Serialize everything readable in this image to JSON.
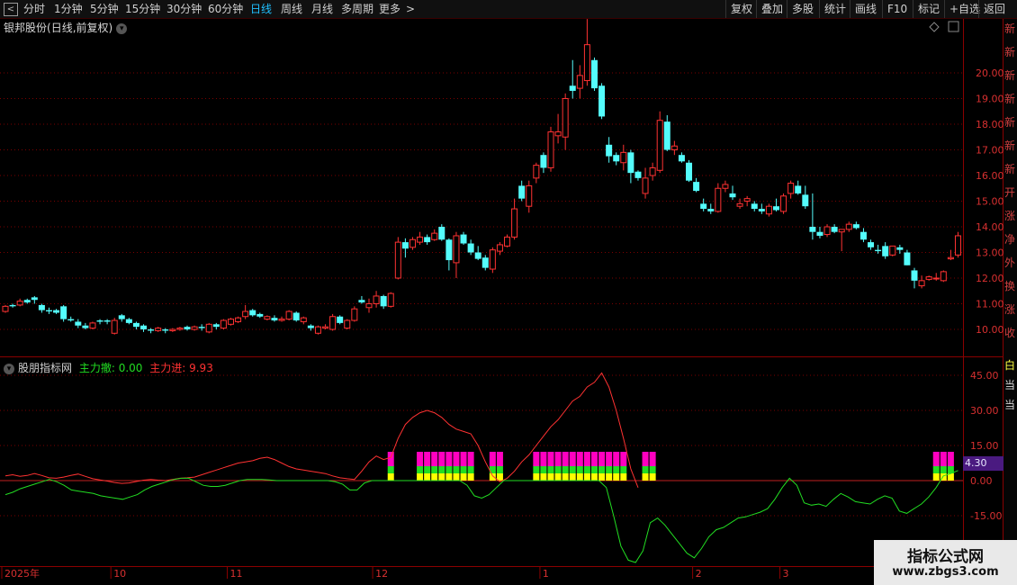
{
  "toolbar": {
    "periods": [
      "分时",
      "1分钟",
      "5分钟",
      "15分钟",
      "30分钟",
      "60分钟",
      "日线",
      "周线",
      "月线",
      "多周期",
      "更多"
    ],
    "more_arrow": ">",
    "right_buttons": [
      "复权",
      "叠加",
      "多股",
      "统计",
      "画线",
      "F10",
      "标记",
      "+自选",
      "返回"
    ]
  },
  "main_chart": {
    "stock_name": "银邦股份",
    "period_label": "(日线,前复权)",
    "y_labels": [
      "20.00",
      "19.00",
      "18.00",
      "17.00",
      "16.00",
      "15.00",
      "14.00",
      "13.00",
      "12.00",
      "11.00",
      "10.00"
    ]
  },
  "indicator": {
    "name": "股朋指标网",
    "out_label": "主力撤: 0.00",
    "in_label": "主力进: 9.93",
    "y_labels": [
      "45.00",
      "30.00",
      "15.00",
      "0.00",
      "-15.00"
    ],
    "current_tag": "4.30"
  },
  "x_axis": {
    "labels": [
      "2025年",
      "10",
      "11",
      "12",
      "1",
      "2",
      "3"
    ]
  },
  "right_strip": {
    "upper_chars": "新新新新新新新开涨净外换涨收",
    "lower_chars": "白当当"
  },
  "watermark": {
    "line1": "指标公式网",
    "line2": "www.zbgs3.com"
  },
  "colors": {
    "up": "#ff3232",
    "down": "#54fcfc",
    "green_line": "#22dd22",
    "magenta": "#ff00c0",
    "yellow": "#ffff00",
    "grid": "#7a0000"
  },
  "chart_data": {
    "type": "candlestick",
    "candles": [
      [
        10.7,
        10.95,
        10.65,
        10.9
      ],
      [
        10.95,
        11.0,
        10.85,
        10.9
      ],
      [
        10.95,
        11.2,
        10.9,
        11.1
      ],
      [
        11.15,
        11.2,
        11.0,
        11.05
      ],
      [
        11.25,
        11.3,
        11.0,
        11.15
      ],
      [
        10.95,
        11.0,
        10.65,
        10.75
      ],
      [
        10.75,
        10.85,
        10.6,
        10.7
      ],
      [
        10.75,
        10.8,
        10.6,
        10.65
      ],
      [
        10.9,
        10.95,
        10.3,
        10.4
      ],
      [
        10.4,
        10.5,
        10.3,
        10.35
      ],
      [
        10.3,
        10.4,
        10.05,
        10.15
      ],
      [
        10.15,
        10.25,
        10.0,
        10.05
      ],
      [
        10.05,
        10.3,
        10.0,
        10.25
      ],
      [
        10.35,
        10.4,
        10.2,
        10.3
      ],
      [
        10.35,
        10.4,
        10.2,
        10.3
      ],
      [
        9.85,
        10.45,
        9.8,
        10.35
      ],
      [
        10.55,
        10.6,
        10.3,
        10.4
      ],
      [
        10.4,
        10.45,
        10.2,
        10.25
      ],
      [
        10.25,
        10.3,
        10.0,
        10.1
      ],
      [
        10.15,
        10.2,
        9.9,
        10.0
      ],
      [
        10.0,
        10.05,
        9.85,
        9.95
      ],
      [
        9.95,
        10.1,
        9.9,
        10.05
      ],
      [
        10.0,
        10.05,
        9.85,
        9.95
      ],
      [
        9.95,
        10.05,
        9.9,
        10.0
      ],
      [
        10.0,
        10.1,
        9.95,
        10.05
      ],
      [
        10.1,
        10.15,
        9.95,
        10.0
      ],
      [
        10.0,
        10.15,
        9.95,
        10.1
      ],
      [
        10.1,
        10.2,
        9.95,
        10.05
      ],
      [
        9.9,
        10.25,
        9.85,
        10.2
      ],
      [
        10.2,
        10.25,
        10.0,
        10.1
      ],
      [
        10.05,
        10.4,
        10.0,
        10.35
      ],
      [
        10.2,
        10.45,
        10.15,
        10.4
      ],
      [
        10.3,
        10.5,
        10.25,
        10.45
      ],
      [
        10.5,
        10.95,
        10.4,
        10.7
      ],
      [
        10.75,
        10.8,
        10.5,
        10.55
      ],
      [
        10.6,
        10.65,
        10.45,
        10.5
      ],
      [
        10.4,
        10.55,
        10.35,
        10.5
      ],
      [
        10.45,
        10.55,
        10.3,
        10.35
      ],
      [
        10.35,
        10.5,
        10.3,
        10.4
      ],
      [
        10.4,
        10.75,
        10.35,
        10.7
      ],
      [
        10.65,
        10.7,
        10.3,
        10.35
      ],
      [
        10.3,
        10.5,
        10.2,
        10.45
      ],
      [
        10.15,
        10.2,
        9.95,
        10.05
      ],
      [
        9.85,
        10.15,
        9.8,
        10.1
      ],
      [
        10.05,
        10.2,
        10.0,
        10.1
      ],
      [
        10.0,
        10.6,
        9.95,
        10.5
      ],
      [
        10.5,
        10.55,
        10.2,
        10.25
      ],
      [
        10.05,
        10.4,
        10.0,
        10.35
      ],
      [
        10.35,
        10.9,
        10.3,
        10.8
      ],
      [
        11.15,
        11.3,
        11.0,
        11.05
      ],
      [
        10.85,
        11.2,
        10.65,
        11.0
      ],
      [
        11.0,
        11.5,
        10.85,
        11.3
      ],
      [
        11.3,
        11.35,
        10.8,
        10.9
      ],
      [
        10.9,
        11.45,
        10.85,
        11.4
      ],
      [
        12.0,
        13.6,
        11.95,
        13.4
      ],
      [
        13.4,
        13.55,
        12.8,
        13.15
      ],
      [
        13.2,
        13.6,
        13.1,
        13.5
      ],
      [
        13.4,
        13.8,
        13.3,
        13.6
      ],
      [
        13.6,
        13.7,
        13.3,
        13.4
      ],
      [
        13.5,
        13.9,
        13.45,
        13.75
      ],
      [
        14.0,
        14.1,
        13.45,
        13.5
      ],
      [
        13.5,
        13.55,
        12.3,
        12.7
      ],
      [
        12.6,
        13.8,
        12.0,
        13.65
      ],
      [
        13.7,
        13.8,
        13.3,
        13.35
      ],
      [
        13.35,
        13.5,
        12.9,
        13.0
      ],
      [
        13.0,
        13.25,
        12.7,
        12.75
      ],
      [
        12.8,
        12.9,
        12.3,
        12.4
      ],
      [
        12.35,
        13.2,
        12.2,
        13.1
      ],
      [
        13.05,
        13.4,
        12.9,
        13.3
      ],
      [
        13.25,
        13.7,
        13.2,
        13.6
      ],
      [
        13.6,
        15.1,
        13.5,
        14.7
      ],
      [
        15.6,
        15.8,
        15.0,
        15.1
      ],
      [
        14.8,
        15.8,
        14.55,
        15.6
      ],
      [
        15.9,
        16.5,
        15.7,
        16.4
      ],
      [
        16.8,
        16.9,
        16.1,
        16.3
      ],
      [
        16.3,
        17.9,
        16.15,
        17.7
      ],
      [
        17.55,
        18.4,
        17.25,
        17.7
      ],
      [
        17.5,
        19.2,
        17.0,
        19.0
      ],
      [
        19.5,
        20.5,
        19.0,
        19.3
      ],
      [
        19.4,
        20.3,
        19.0,
        19.9
      ],
      [
        19.7,
        22.1,
        19.5,
        21.1
      ],
      [
        20.5,
        20.6,
        19.3,
        19.4
      ],
      [
        19.5,
        19.6,
        18.2,
        18.3
      ],
      [
        17.2,
        17.5,
        16.5,
        16.75
      ],
      [
        16.8,
        16.9,
        16.4,
        16.55
      ],
      [
        16.5,
        17.2,
        16.2,
        16.9
      ],
      [
        16.9,
        17.0,
        15.7,
        16.1
      ],
      [
        16.15,
        16.2,
        15.8,
        15.9
      ],
      [
        15.3,
        16.3,
        15.1,
        15.9
      ],
      [
        16.0,
        16.5,
        15.8,
        16.3
      ],
      [
        16.2,
        18.5,
        16.1,
        18.15
      ],
      [
        18.1,
        18.35,
        16.95,
        17.0
      ],
      [
        17.0,
        17.35,
        16.8,
        17.15
      ],
      [
        16.8,
        16.9,
        16.5,
        16.55
      ],
      [
        16.5,
        16.6,
        15.75,
        15.8
      ],
      [
        15.75,
        15.9,
        15.35,
        15.4
      ],
      [
        14.9,
        15.1,
        14.6,
        14.7
      ],
      [
        14.7,
        14.9,
        14.5,
        14.6
      ],
      [
        14.6,
        15.7,
        14.55,
        15.5
      ],
      [
        15.5,
        15.8,
        15.35,
        15.65
      ],
      [
        15.3,
        15.6,
        15.05,
        15.15
      ],
      [
        14.8,
        15.1,
        14.7,
        14.9
      ],
      [
        15.0,
        15.2,
        14.8,
        15.1
      ],
      [
        14.9,
        15.0,
        14.6,
        14.7
      ],
      [
        14.7,
        14.9,
        14.5,
        14.6
      ],
      [
        14.5,
        14.9,
        14.4,
        14.8
      ],
      [
        14.8,
        15.1,
        14.6,
        14.65
      ],
      [
        14.6,
        15.3,
        14.5,
        15.2
      ],
      [
        15.3,
        15.8,
        15.1,
        15.7
      ],
      [
        15.6,
        15.8,
        15.25,
        15.3
      ],
      [
        15.25,
        15.6,
        14.7,
        14.8
      ],
      [
        14.0,
        15.3,
        13.5,
        13.8
      ],
      [
        13.8,
        14.0,
        13.55,
        13.65
      ],
      [
        13.7,
        14.1,
        13.6,
        14.0
      ],
      [
        14.0,
        14.1,
        13.75,
        13.8
      ],
      [
        13.8,
        13.9,
        13.05,
        13.9
      ],
      [
        13.9,
        14.2,
        13.8,
        14.1
      ],
      [
        14.1,
        14.2,
        13.9,
        13.95
      ],
      [
        13.8,
        13.95,
        13.4,
        13.5
      ],
      [
        13.4,
        13.5,
        13.1,
        13.2
      ],
      [
        13.1,
        13.3,
        12.95,
        13.05
      ],
      [
        13.25,
        13.4,
        12.75,
        12.85
      ],
      [
        12.9,
        13.25,
        12.85,
        13.25
      ],
      [
        13.2,
        13.3,
        12.95,
        13.1
      ],
      [
        13.0,
        13.1,
        12.5,
        12.5
      ],
      [
        12.3,
        12.4,
        11.6,
        11.9
      ],
      [
        11.7,
        12.1,
        11.6,
        11.9
      ],
      [
        11.95,
        12.1,
        11.9,
        12.05
      ],
      [
        12.0,
        12.2,
        11.9,
        12.0
      ],
      [
        11.9,
        12.3,
        11.85,
        12.25
      ],
      [
        12.75,
        13.1,
        12.7,
        12.8
      ],
      [
        12.9,
        13.8,
        12.8,
        13.65
      ]
    ],
    "indicator_red": [
      2.0,
      2.5,
      1.8,
      2.2,
      3.0,
      2.2,
      1.2,
      1.0,
      1.5,
      2.2,
      2.8,
      1.8,
      0.8,
      0.3,
      -0.2,
      -0.8,
      -1.2,
      -1.0,
      -0.4,
      0.2,
      0.5,
      0.2,
      0.0,
      0.5,
      1.0,
      1.2,
      1.5,
      2.5,
      3.5,
      4.5,
      5.5,
      6.5,
      7.5,
      8.0,
      8.5,
      9.5,
      10.0,
      9.0,
      7.5,
      6.0,
      5.0,
      4.5,
      4.0,
      3.5,
      3.0,
      2.0,
      1.2,
      0.8,
      0.5,
      4.0,
      8.0,
      10.5,
      9.0,
      9.93,
      18.0,
      24.0,
      27.0,
      29.0,
      30.0,
      29.0,
      27.0,
      24.0,
      22.0,
      21.0,
      20.0,
      15.0,
      8.0,
      2.0,
      -0.5,
      1.0,
      4.0,
      8.0,
      11.0,
      15.0,
      19.0,
      23.0,
      26.0,
      30.0,
      34.0,
      36.0,
      40.0,
      42.0,
      46.0,
      40.0,
      30.0,
      18.0,
      5.0,
      -3.0
    ],
    "indicator_green": [
      -6.0,
      -5.0,
      -3.5,
      -2.5,
      -1.5,
      -0.5,
      0.5,
      -0.5,
      -2.0,
      -4.0,
      -4.5,
      -5.0,
      -5.5,
      -6.5,
      -7.0,
      -7.5,
      -8.0,
      -7.0,
      -6.0,
      -4.0,
      -2.5,
      -1.5,
      -0.5,
      0.5,
      1.0,
      1.0,
      -0.5,
      -2.0,
      -2.5,
      -2.5,
      -2.0,
      -1.0,
      0.0,
      0.5,
      0.5,
      0.5,
      0.3,
      0.0,
      0.0,
      0.0,
      0.0,
      0.0,
      0.0,
      0.0,
      0.0,
      -0.5,
      -1.5,
      -4.0,
      -4.0,
      -1.0,
      0.0,
      0.0,
      0.0,
      0.0,
      0.0,
      0.0,
      0.0,
      0.0,
      0.0,
      0.0,
      0.0,
      0.0,
      0.0,
      -2.0,
      -6.5,
      -7.5,
      -6.0,
      -3.0,
      0.0,
      0.0,
      0.0,
      0.0,
      0.0,
      0.0,
      0.0,
      0.0,
      0.0,
      0.0,
      0.0,
      0.0,
      0.0,
      0.0,
      -3.0,
      -15.0,
      -28.0,
      -34.0,
      -35.0,
      -30.0,
      -18.0,
      -16.0,
      -19.0,
      -23.0,
      -27.0,
      -31.0,
      -33.0,
      -29.0,
      -24.0,
      -21.0,
      -20.0,
      -18.0,
      -16.0,
      -15.5,
      -14.5,
      -13.5,
      -12.0,
      -8.0,
      -3.0,
      1.0,
      -2.0,
      -9.5,
      -10.5,
      -10.0,
      -11.0,
      -8.0,
      -5.5,
      -7.0,
      -9.0,
      -9.5,
      -10.0,
      -8.0,
      -6.5,
      -7.5,
      -13.0,
      -14.0,
      -12.0,
      -10.0,
      -7.0,
      -3.0,
      2.0,
      3.0,
      4.3
    ],
    "signal_bars": [
      53,
      57,
      58,
      59,
      60,
      61,
      62,
      63,
      64,
      67,
      68,
      73,
      74,
      75,
      76,
      77,
      78,
      79,
      80,
      81,
      82,
      83,
      84,
      85,
      88,
      89,
      128,
      129,
      130
    ],
    "y_range_price": [
      9.5,
      22.5
    ],
    "y_range_indicator": [
      -25,
      50
    ],
    "x_month_label_positions": [
      0,
      15,
      31,
      51,
      74,
      95,
      107
    ]
  }
}
